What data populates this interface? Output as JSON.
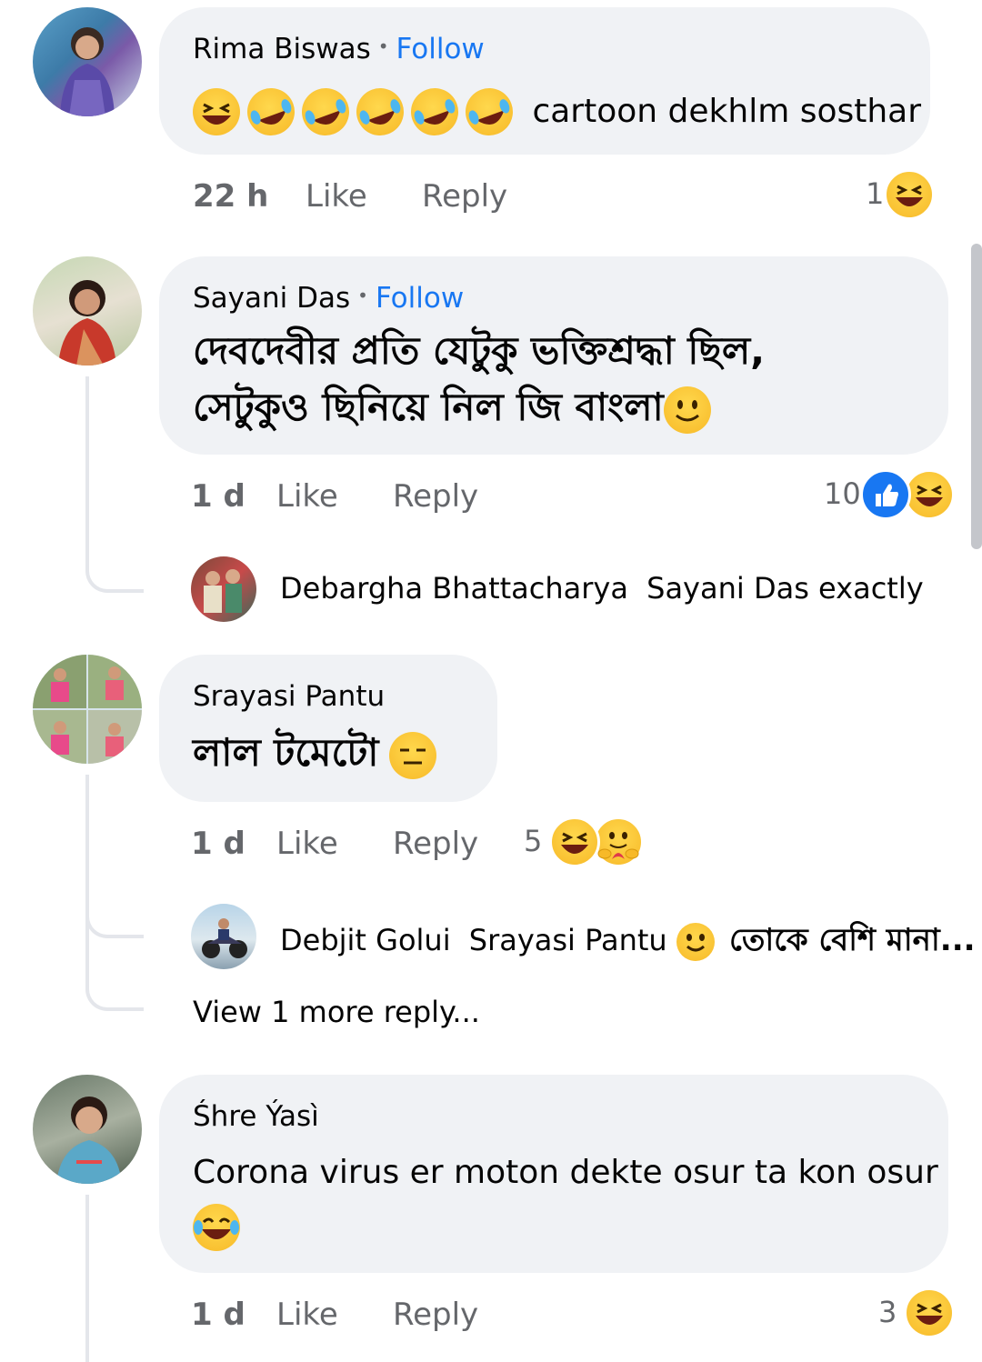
{
  "comments": [
    {
      "name": "Rima Biswas",
      "follow": "Follow",
      "text": "cartoon dekhlm sosthar",
      "time": "22 h",
      "like": "Like",
      "reply": "Reply",
      "reactions_count": "1",
      "reaction_types": [
        "haha"
      ]
    },
    {
      "name": "Sayani Das",
      "follow": "Follow",
      "text_line1": "দেবদেবীর প্রতি যেটুকু ভক্তিশ্রদ্ধা ছিল,",
      "text_line2": "সেটুকুও ছিনিয়ে নিল জি বাংলা",
      "time": "1 d",
      "like": "Like",
      "reply": "Reply",
      "reactions_count": "10",
      "reaction_types": [
        "like",
        "haha"
      ],
      "replies": [
        {
          "name": "Debargha Bhattacharya",
          "mention": "Sayani Das",
          "text": "exactly"
        }
      ]
    },
    {
      "name": "Srayasi Pantu",
      "text": "লাল টমেটো",
      "time": "1 d",
      "like": "Like",
      "reply": "Reply",
      "reactions_count": "5",
      "reaction_types": [
        "haha",
        "care"
      ],
      "replies": [
        {
          "name": "Debjit Golui",
          "mention": "Srayasi Pantu",
          "text": "তোকে বেশি মানা..."
        }
      ],
      "view_more": "View 1 more reply..."
    },
    {
      "name": "Śhre Ýasì",
      "text": "Corona virus er moton dekte osur ta kon osur",
      "time": "1 d",
      "like": "Like",
      "reply": "Reply",
      "reactions_count": "3",
      "reaction_types": [
        "haha"
      ]
    }
  ],
  "colors": {
    "bubble": "#f0f2f5",
    "follow": "#1877f2",
    "meta": "#65676b",
    "like_reaction": "#1877f2",
    "emoji_yellow": "#f7b928"
  },
  "icons": [
    "haha-emoji",
    "rofl-emoji",
    "smile-emoji",
    "expressionless-emoji",
    "care-emoji",
    "like-reaction-icon",
    "laughing-tears-emoji"
  ]
}
